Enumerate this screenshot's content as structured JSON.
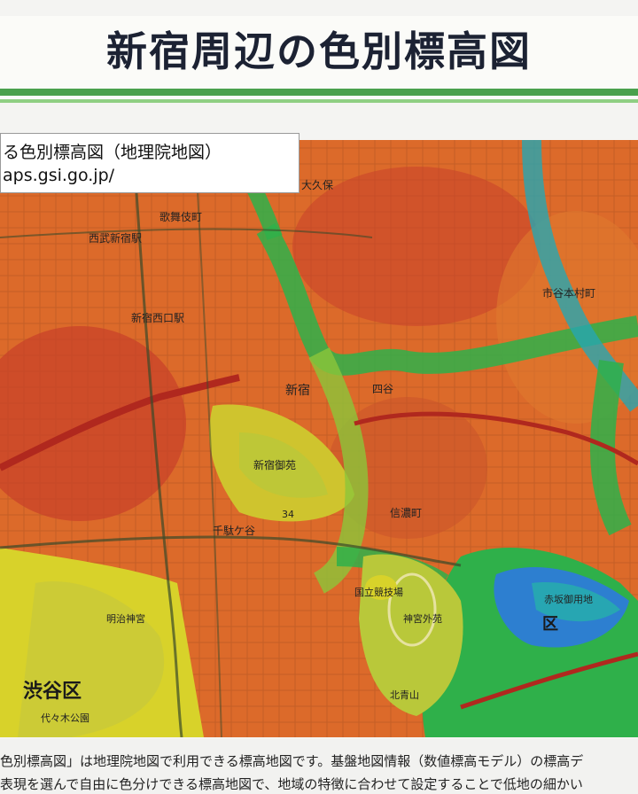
{
  "header": {
    "title": "新宿周辺の色別標高図"
  },
  "source": {
    "title": "る色別標高図（地理院地図）",
    "url": "aps.gsi.go.jp/"
  },
  "map": {
    "labels": {
      "shinjuku_nishiguchi": "新宿西口駅",
      "shinjuku": "新宿",
      "shinjuku_gyoen": "新宿御苑",
      "shibuya_ward": "渋谷区",
      "meiji_jingu": "明治神宮",
      "yoyogi_park": "代々木公園",
      "jingu_gaien": "神宮外苑",
      "kokuritsu": "国立競技場",
      "ichigaya": "市谷本村町",
      "akasaka": "赤坂御用地",
      "kita_aoyama": "北青山",
      "minato_ward": "区",
      "shinanomachi": "信濃町",
      "yotsuya": "四谷",
      "sendagaya": "千駄ケ谷",
      "kabukicho": "歌舞伎町",
      "okubo": "大久保",
      "seibu_shinjuku": "西武新宿駅",
      "route_num": "34"
    },
    "elevation_palette": [
      "#2d7fd0",
      "#27a6b2",
      "#2fb04a",
      "#8cc63a",
      "#d8d22a",
      "#e8a233",
      "#dc6a2a",
      "#c8402a",
      "#9e2a22"
    ]
  },
  "caption": {
    "line1": "色別標高図」は地理院地図で利用できる標高地図です。基盤地図情報（数値標高モデル）の標高デ",
    "line2": "表現を選んで自由に色分けできる標高地図で、地域の特徴に合わせて設定することで低地の細かい"
  }
}
